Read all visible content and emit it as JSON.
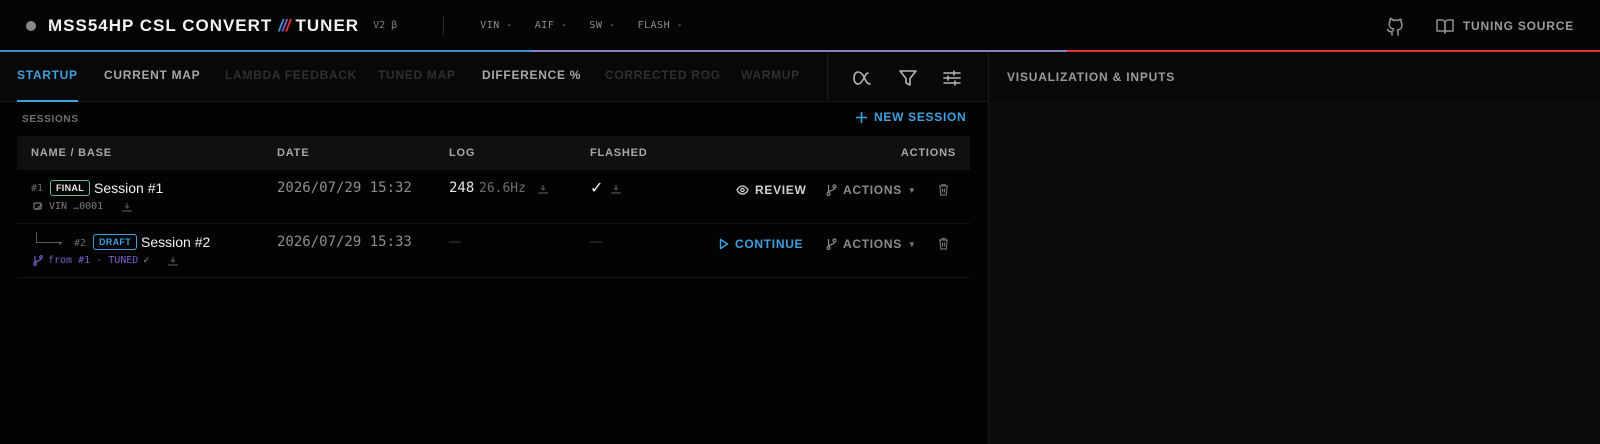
{
  "header": {
    "title_left": "MSS54HP CSL CONVERT",
    "slash1": "/",
    "slash2": "/",
    "slash3": "/",
    "title_right": "TUNER",
    "version": "V2 β",
    "stats": [
      {
        "label": "VIN -"
      },
      {
        "label": "AIF -"
      },
      {
        "label": "SW -"
      },
      {
        "label": "FLASH -"
      }
    ],
    "tuning_source": "TUNING SOURCE",
    "accent_colors": [
      "#3d8fd1",
      "#8a7fc0",
      "#e0303b"
    ]
  },
  "tabs": [
    {
      "label": "STARTUP"
    },
    {
      "label": "CURRENT MAP"
    },
    {
      "label": "LAMBDA FEEDBACK"
    },
    {
      "label": "TUNED MAP"
    },
    {
      "label": "DIFFERENCE %"
    },
    {
      "label": "CORRECTED ROG"
    },
    {
      "label": "WARMUP"
    }
  ],
  "right_pane": {
    "title": "VISUALIZATION & INPUTS"
  },
  "sessions": {
    "label": "SESSIONS",
    "new_session": "NEW SESSION",
    "columns": [
      "NAME / BASE",
      "DATE",
      "LOG",
      "FLASHED",
      "ACTIONS"
    ],
    "rows": [
      {
        "index": "#1",
        "badge": "FINAL",
        "name": "Session #1",
        "sub": "VIN …0001",
        "date": "2026/07/29 15:32",
        "log_count": "248",
        "log_hz": "26.6Hz",
        "flashed": "✓",
        "primary_action": "REVIEW",
        "actions_label": "ACTIONS"
      },
      {
        "index": "#2",
        "badge": "DRAFT",
        "name": "Session #2",
        "sub": "from #1 · TUNED",
        "sub_check": "✓",
        "date": "2026/07/29 15:33",
        "log_count": "—",
        "flashed": "—",
        "primary_action": "CONTINUE",
        "actions_label": "ACTIONS"
      }
    ]
  },
  "colors": {
    "accent_blue": "#3fa0e0",
    "purple": "#7b5cc4",
    "red": "#e0303b",
    "teal_badge": "#5fb4a8"
  }
}
